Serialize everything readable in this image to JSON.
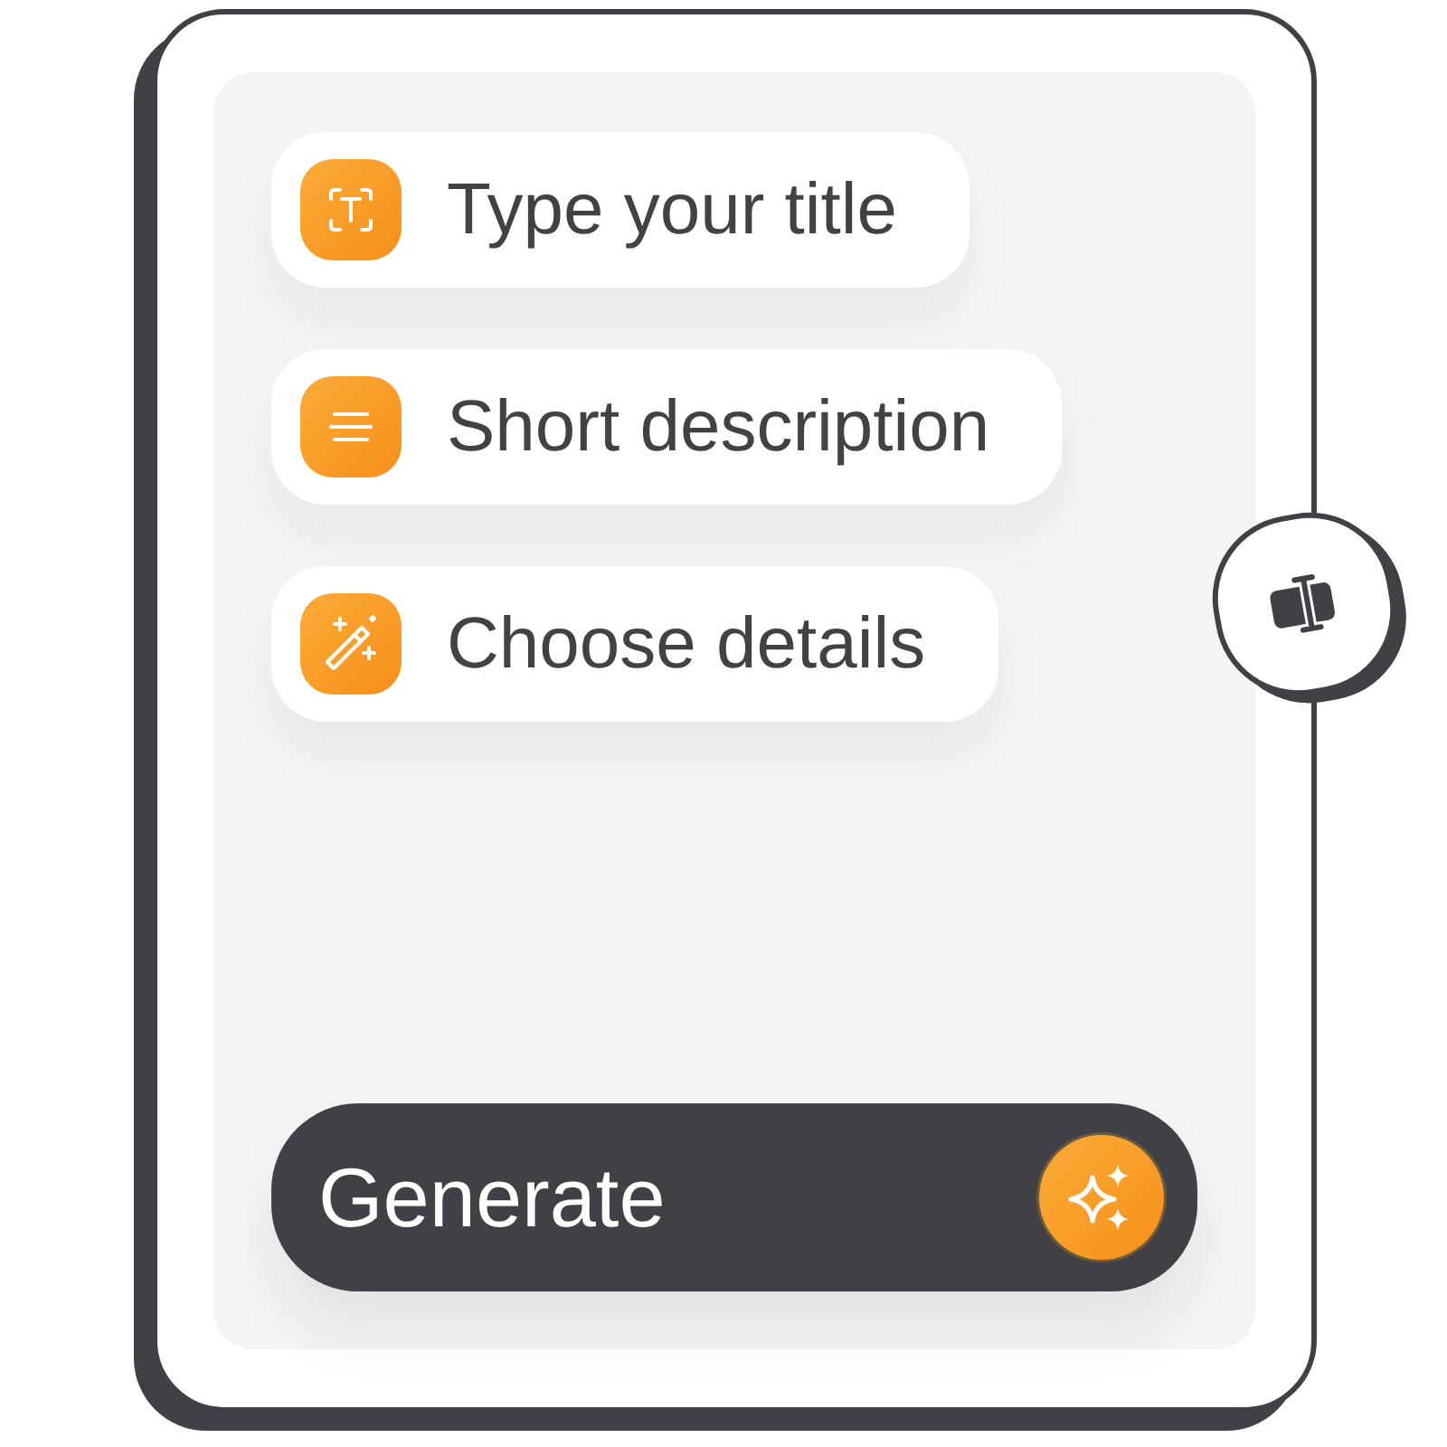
{
  "fields": [
    {
      "kind": "title",
      "label": "Type your title"
    },
    {
      "kind": "description",
      "label": "Short description"
    },
    {
      "kind": "details",
      "label": "Choose details"
    }
  ],
  "generate_button": {
    "label": "Generate"
  }
}
